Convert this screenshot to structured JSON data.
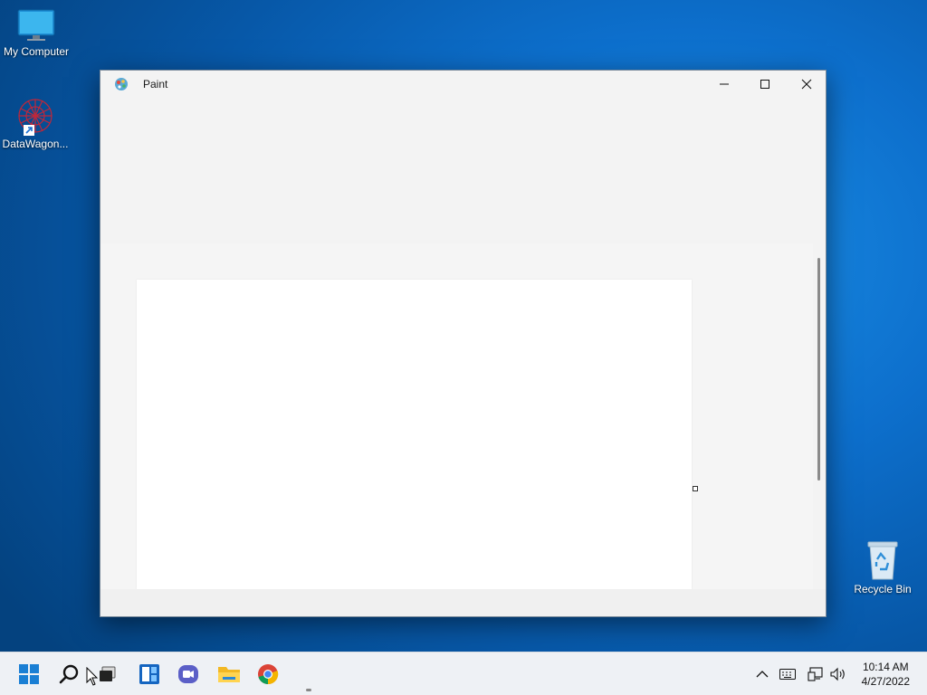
{
  "desktop": {
    "icons": [
      {
        "label": "My Computer",
        "icon": "monitor-icon"
      },
      {
        "label": "DataWagon...",
        "icon": "datawagon-icon"
      },
      {
        "label": "Recycle Bin",
        "icon": "recycle-bin-icon"
      }
    ]
  },
  "window": {
    "title": "Paint",
    "app_icon": "paint-icon",
    "minimize_icon": "minimize-icon",
    "maximize_icon": "maximize-icon",
    "close_icon": "close-icon"
  },
  "taskbar": {
    "items": [
      "start-icon",
      "search-icon",
      "task-view-icon",
      "widgets-icon",
      "chat-icon",
      "file-explorer-icon",
      "chrome-icon"
    ],
    "tray": [
      "chevron-up-icon",
      "keyboard-icon",
      "network-icon",
      "volume-icon"
    ],
    "time": "10:14 AM",
    "date": "4/27/2022"
  },
  "colors": {
    "desktop_accent": "#0d6fcc",
    "window_bg": "#f3f3f3",
    "canvas": "#ffffff",
    "taskbar": "#eef1f5"
  }
}
